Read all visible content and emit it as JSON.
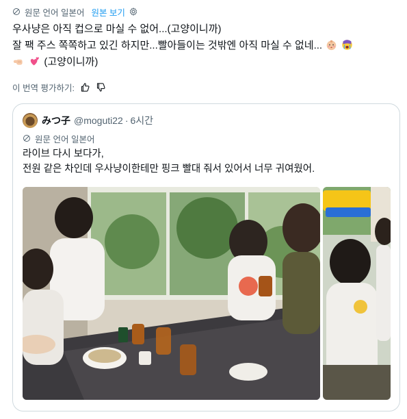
{
  "translation": {
    "label": "원문 언어 일본어",
    "show_original": "원본 보기"
  },
  "tweet": {
    "lines": [
      "우사냥은 아직 컵으로 마실 수 없어...(고양이니까)",
      "잘 팩 주스 쪽쪽하고 있긴 하지만...빨아들이는 것밖엔 아직 마실 수 없네...",
      "(고양이니까)"
    ],
    "emojis": [
      "baby-face",
      "crying-face",
      "pointing-hand",
      "two-hearts"
    ]
  },
  "rating": {
    "label": "이 번역 평가하기:"
  },
  "quote": {
    "author_name": "みつ子",
    "handle": "@moguti22",
    "separator": "·",
    "time": "6시간",
    "translation_label": "원문 언어 일본어",
    "lines": [
      "라이브 다시 보다가,",
      "전원 같은 차인데 우사냥이한테만 핑크 빨대 줘서 있어서 너무 귀여웠어."
    ]
  },
  "colors": {
    "link": "#1d9bf0",
    "muted": "#536471",
    "text": "#0f1419",
    "border": "#cfd9de"
  }
}
